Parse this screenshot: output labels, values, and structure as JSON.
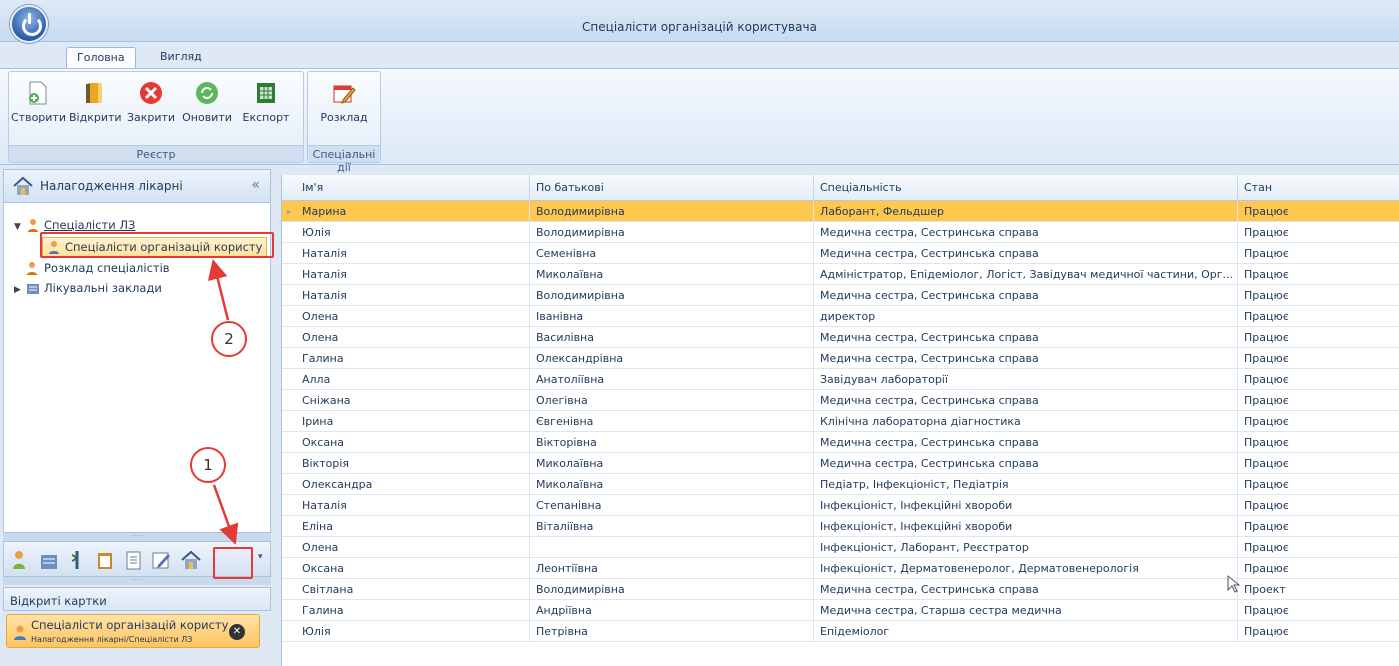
{
  "window": {
    "title": "Спеціалісти організацій користувача"
  },
  "tabs": [
    {
      "label": "Головна",
      "active": true
    },
    {
      "label": "Вигляд",
      "active": false
    }
  ],
  "ribbon": {
    "groups": [
      {
        "label": "Реєстр",
        "buttons": [
          "Створити",
          "Відкрити",
          "Закрити",
          "Оновити",
          "Експорт"
        ]
      },
      {
        "label": "Спеціальні дії",
        "buttons": [
          "Розклад"
        ]
      }
    ]
  },
  "nav": {
    "header": "Налагодження лікарні",
    "collapse": "«",
    "tree": [
      {
        "label": "Спеціалісти ЛЗ",
        "expanded": true
      },
      {
        "label": "Спеціалісти організацій користу",
        "selected": true
      },
      {
        "label": "Розклад спеціалістів"
      },
      {
        "label": "Лікувальні заклади"
      }
    ],
    "splitter": "·····",
    "dropdown": "▾"
  },
  "open_cards": {
    "header": "Відкриті картки",
    "card": {
      "title": "Спеціалісти організацій користу",
      "path": "Налагодження лікарні/Спеціалісти ЛЗ"
    }
  },
  "grid": {
    "columns": [
      "Ім'я",
      "По батькові",
      "Спеціальність",
      "Стан"
    ],
    "rows": [
      [
        "Марина",
        "Володимирівна",
        "Лаборант, Фельдшер",
        "Працює"
      ],
      [
        "Юлія",
        "Володимирівна",
        "Медична сестра, Сестринська справа",
        "Працює"
      ],
      [
        "Наталія",
        "Семенівна",
        "Медична сестра, Сестринська справа",
        "Працює"
      ],
      [
        "Наталія",
        "Миколаївна",
        "Адміністратор, Епідеміолог, Логіст, Завідувач медичної частини, Орг...",
        "Працює"
      ],
      [
        "Наталія",
        "Володимирівна",
        "Медична сестра, Сестринська справа",
        "Працює"
      ],
      [
        "Олена",
        "Іванівна",
        "директор",
        "Працює"
      ],
      [
        "Олена",
        "Василівна",
        "Медична сестра, Сестринська справа",
        "Працює"
      ],
      [
        "Галина",
        "Олександрівна",
        "Медична сестра, Сестринська справа",
        "Працює"
      ],
      [
        "Алла",
        "Анатоліївна",
        "Завідувач лабораторії",
        "Працює"
      ],
      [
        "Сніжана",
        "Олегівна",
        "Медична сестра, Сестринська справа",
        "Працює"
      ],
      [
        "Ірина",
        "Євгенівна",
        "Клінічна лабораторна діагностика",
        "Працює"
      ],
      [
        "Оксана",
        "Вікторівна",
        "Медична сестра, Сестринська справа",
        "Працює"
      ],
      [
        "Вікторія",
        "Миколаївна",
        "Медична сестра, Сестринська справа",
        "Працює"
      ],
      [
        "Олександра",
        "Миколаївна",
        "Педіатр, Інфекціоніст, Педіатрія",
        "Працює"
      ],
      [
        "Наталія",
        "Степанівна",
        "Інфекціоніст, Інфекційні хвороби",
        "Працює"
      ],
      [
        "Еліна",
        "Віталіївна",
        "Інфекціоніст, Інфекційні хвороби",
        "Працює"
      ],
      [
        "Олена",
        "",
        "Інфекціоніст, Лаборант, Реєстратор",
        "Працює"
      ],
      [
        "Оксана",
        "Леонтіївна",
        "Інфекціоніст, Дерматовенеролог, Дерматовенерологія",
        "Працює"
      ],
      [
        "Світлана",
        "Володимирівна",
        "Медична сестра, Сестринська справа",
        "Проект"
      ],
      [
        "Галина",
        "Андріївна",
        "Медична сестра, Старша сестра медична",
        "Працює"
      ],
      [
        "Юлія",
        "Петрівна",
        "Епідеміолог",
        "Працює"
      ]
    ],
    "selected_row": 0
  },
  "annotations": [
    "1",
    "2"
  ],
  "colors": {
    "selection": "#ffc74d",
    "annotation": "#e53935",
    "ribbon": "#dce8f6"
  }
}
